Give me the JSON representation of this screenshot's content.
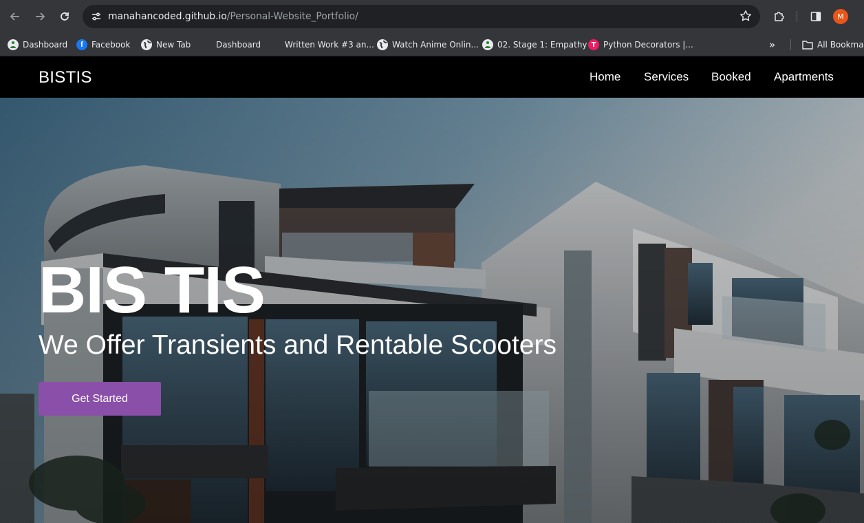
{
  "browser": {
    "url_host": "manahancoded.github.io",
    "url_path": "/Personal-Website_Portfolio/",
    "profile_initial": "M",
    "bookmarks": [
      {
        "label": "Dashboard",
        "icon": "dashboard-favicon"
      },
      {
        "label": "Facebook",
        "icon": "facebook-favicon"
      },
      {
        "label": "New Tab",
        "icon": "globe-favicon"
      },
      {
        "label": "Dashboard",
        "icon": "microsoft-favicon"
      },
      {
        "label": "Written Work #3 an...",
        "icon": "microsoft-favicon"
      },
      {
        "label": "Watch Anime Onlin...",
        "icon": "globe-favicon"
      },
      {
        "label": "02. Stage 1: Empathy",
        "icon": "dashboard-favicon"
      },
      {
        "label": "Python Decorators |...",
        "icon": "python-favicon"
      }
    ],
    "all_bookmarks_label": "All Bookmarks",
    "overflow_label": "»"
  },
  "site": {
    "brand": "BISTIS",
    "nav": [
      "Home",
      "Services",
      "Booked",
      "Apartments"
    ],
    "hero_title": "BIS TIS",
    "hero_subtitle": "We Offer Transients and Rentable Scooters",
    "cta_label": "Get Started"
  },
  "colors": {
    "nav_bg": "#000000",
    "cta": "#8a4fa8",
    "chrome_bg": "#35363a",
    "omnibox_bg": "#202124"
  }
}
